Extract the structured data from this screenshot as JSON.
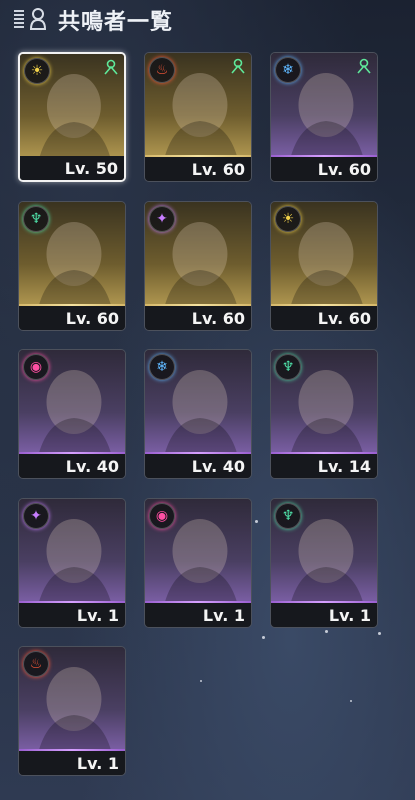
{
  "header": {
    "title": "共鳴者一覧"
  },
  "resonators": [
    {
      "level": "Lv. 50",
      "element": "spectro",
      "rarity": 5,
      "role": true,
      "selected": true
    },
    {
      "level": "Lv. 60",
      "element": "fusion",
      "rarity": 5,
      "role": true,
      "selected": false
    },
    {
      "level": "Lv. 60",
      "element": "glacio",
      "rarity": 4,
      "role": true,
      "selected": false
    },
    {
      "level": "Lv. 60",
      "element": "aero",
      "rarity": 5,
      "role": false,
      "selected": false
    },
    {
      "level": "Lv. 60",
      "element": "havoc",
      "rarity": 5,
      "role": false,
      "selected": false
    },
    {
      "level": "Lv. 60",
      "element": "spectro",
      "rarity": 5,
      "role": false,
      "selected": false
    },
    {
      "level": "Lv. 40",
      "element": "electro",
      "rarity": 4,
      "role": false,
      "selected": false
    },
    {
      "level": "Lv. 40",
      "element": "glacio",
      "rarity": 4,
      "role": false,
      "selected": false
    },
    {
      "level": "Lv. 14",
      "element": "aero",
      "rarity": 4,
      "role": false,
      "selected": false
    },
    {
      "level": "Lv. 1",
      "element": "havoc",
      "rarity": 4,
      "role": false,
      "selected": false
    },
    {
      "level": "Lv. 1",
      "element": "electro",
      "rarity": 4,
      "role": false,
      "selected": false
    },
    {
      "level": "Lv. 1",
      "element": "aero",
      "rarity": 4,
      "role": false,
      "selected": false
    },
    {
      "level": "Lv. 1",
      "element": "fusion",
      "rarity": 4,
      "role": false,
      "selected": false
    }
  ],
  "colors": {
    "spectro": "#f2d24a",
    "fusion": "#ff5a3a",
    "glacio": "#5fb8ff",
    "aero": "#4fe0a8",
    "havoc": "#c77dff",
    "electro": "#ff4fa3"
  },
  "icons": {
    "spectro": "☀",
    "fusion": "♨",
    "glacio": "❄",
    "aero": "♆",
    "havoc": "✦",
    "electro": "◉"
  }
}
